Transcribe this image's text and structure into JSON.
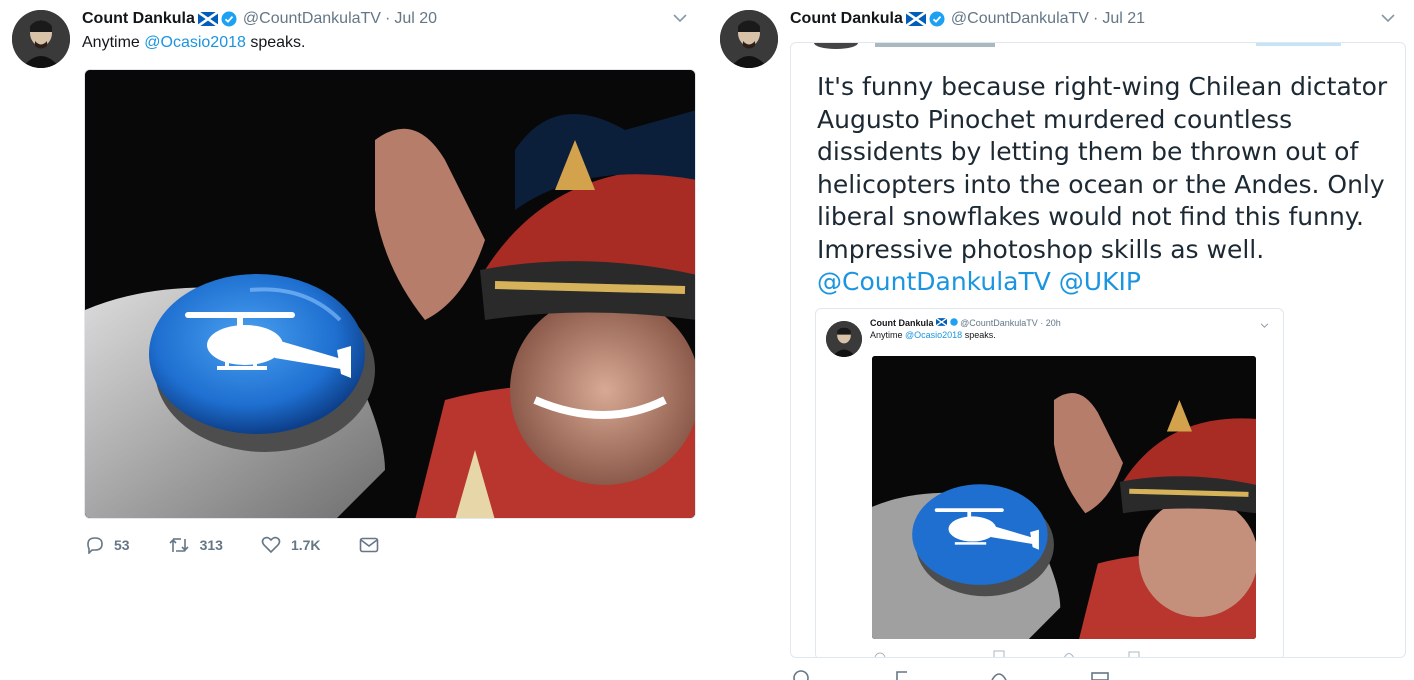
{
  "tweets": [
    {
      "author_name": "Count Dankula",
      "handle": "@CountDankulaTV",
      "separator": "·",
      "date": "Jul 20",
      "text_prefix": "Anytime ",
      "text_mention": "@Ocasio2018",
      "text_suffix": " speaks.",
      "actions": {
        "replies": "53",
        "retweets": "313",
        "likes": "1.7K"
      }
    },
    {
      "author_name": "Count Dankula",
      "handle": "@CountDankulaTV",
      "separator": "·",
      "date": "Jul 21",
      "quoted": {
        "body_lines": [
          "It's funny because right-wing Chilean dictator",
          "Augusto Pinochet murdered countless",
          "dissidents by letting them be thrown out of",
          "helicopters into the ocean or the Andes. Only",
          "liberal snowflakes would not find this funny.",
          "Impressive photoshop skills as well."
        ],
        "mentions": "@CountDankulaTV @UKIP",
        "inner": {
          "author_name": "Count Dankula",
          "handle": "@CountDankulaTV",
          "separator": "·",
          "date": "20h",
          "text_prefix": "Anytime ",
          "text_mention": "@Ocasio2018",
          "text_suffix": " speaks."
        }
      }
    }
  ],
  "colors": {
    "link": "#1b95e0",
    "secondary": "#657786",
    "button_blue": "#1e6fd0"
  },
  "icons": [
    "chevron-down-icon",
    "verified-badge-icon",
    "scotland-flag-icon",
    "reply-icon",
    "retweet-icon",
    "like-icon",
    "direct-message-icon",
    "helicopter-icon"
  ]
}
